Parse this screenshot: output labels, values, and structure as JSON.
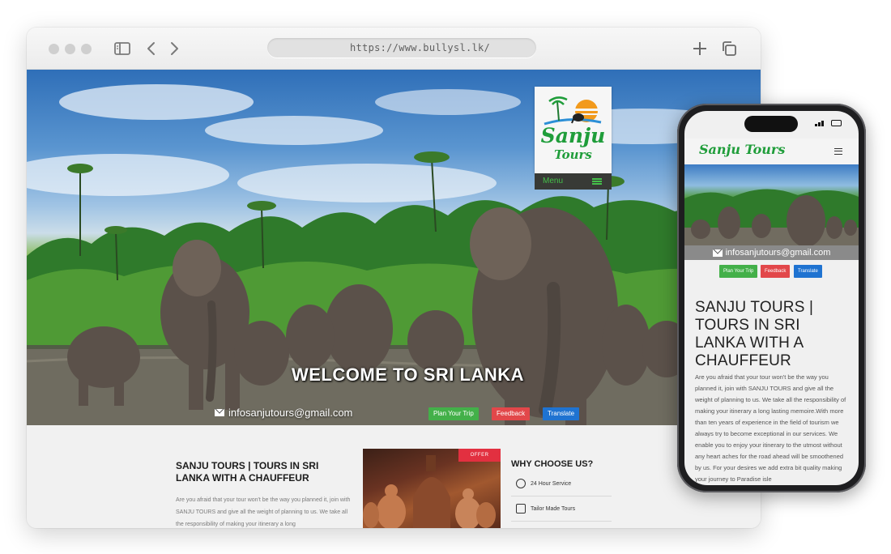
{
  "browser": {
    "url": "https://www.bullysl.lk/"
  },
  "site": {
    "logo_line1": "Sanju",
    "logo_line2": "Tours",
    "menu_label": "Menu",
    "hero_heading": "WELCOME TO SRI LANKA",
    "email": "infosanjutours@gmail.com",
    "buttons": {
      "plan": "Plan Your Trip",
      "feedback": "Feedback",
      "translate": "Translate"
    },
    "article_title": "SANJU TOURS | TOURS IN SRI LANKA WITH A CHAUFFEUR",
    "article_excerpt": "Are you afraid that your tour won't be the way you planned it, join with SANJU TOURS and give all the weight of planning to us. We take all the responsibility of making your itinerary a long",
    "offer_badge": "OFFER",
    "why_title": "WHY CHOOSE US?",
    "why_items": [
      "24 Hour Service",
      "Tailor Made Tours"
    ]
  },
  "mobile": {
    "logo": "Sanju Tours",
    "email": "infosanjutours@gmail.com",
    "buttons": {
      "plan": "Plan Your Trip",
      "feedback": "Feedback",
      "translate": "Translate"
    },
    "title": "SANJU TOURS | TOURS IN SRI LANKA WITH A CHAUFFEUR",
    "body": "Are you afraid that your tour won't be the way you planned it, join with SANJU TOURS and give all the weight of planning to us. We take all the responsibility of making your itinerary a long lasting memoire.With more than ten years of experience in the field of tourism we always try to become exceptional in our services. We enable you to enjoy your itinerary to the utmost without any heart aches for the road ahead will be smoothened by us. For your desires we add extra bit quality making your journey to Paradise isle"
  },
  "colors": {
    "brand_green": "#1f9d3a",
    "plan_button": "#43b049",
    "feedback_button": "#e2474a",
    "translate_button": "#1f73d1",
    "offer_badge": "#e23040"
  }
}
